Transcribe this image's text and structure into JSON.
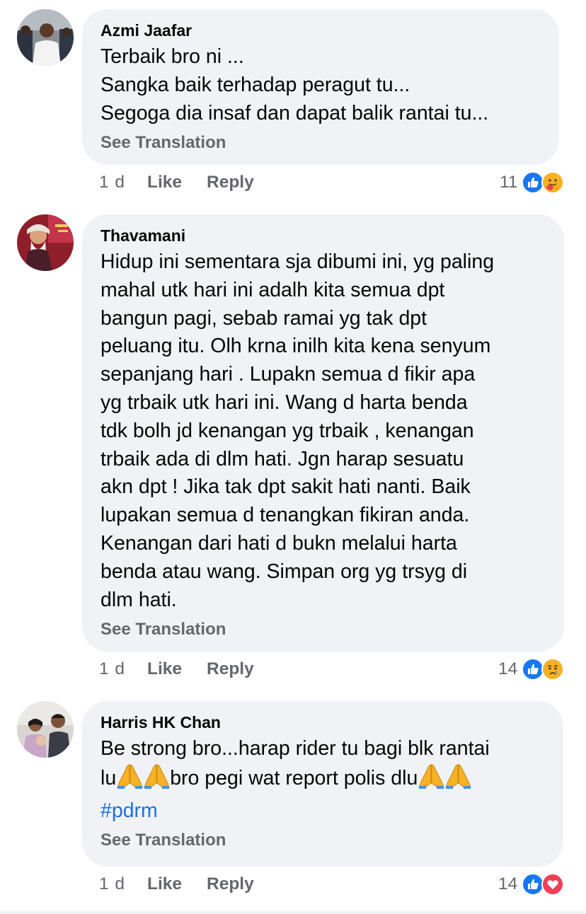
{
  "comments": [
    {
      "author": "Azmi Jaafar",
      "lines": [
        "Terbaik bro ni ...",
        "Sangka baik terhadap peragut tu...",
        "Segoga dia insaf dan dapat balik rantai tu..."
      ],
      "see_translation": "See Translation",
      "time": "1 d",
      "like": "Like",
      "reply": "Reply",
      "reaction_count": "11",
      "reactions": [
        "like-icon",
        "care-icon"
      ]
    },
    {
      "author": "Thavamani",
      "lines": [
        "Hidup ini sementara sja dibumi ini, yg paling",
        "mahal utk hari ini adalh kita semua dpt",
        "bangun pagi, sebab ramai yg tak dpt",
        "peluang itu. Olh krna inilh kita kena senyum",
        "sepanjang hari . Lupakn semua d fikir apa",
        "yg trbaik utk hari ini. Wang d harta benda",
        "tdk bolh jd kenangan yg trbaik , kenangan",
        "trbaik ada di dlm hati. Jgn harap sesuatu",
        "akn dpt ! Jika tak dpt sakit hati nanti. Baik",
        "lupakan semua d tenangkan fikiran anda.",
        "Kenangan dari hati d bukn melalui harta",
        "benda atau wang. Simpan org yg trsyg di",
        "dlm hati."
      ],
      "see_translation": "See Translation",
      "time": "1 d",
      "like": "Like",
      "reply": "Reply",
      "reaction_count": "14",
      "reactions": [
        "like-icon",
        "sad-icon"
      ]
    },
    {
      "author": "Harris HK Chan",
      "line1": "Be strong bro...harap rider tu bagi blk rantai",
      "line2_a": "lu",
      "line2_b": "bro pegi wat report polis dlu",
      "emoji": "🙏",
      "hashtag": "#pdrm",
      "see_translation": "See Translation",
      "time": "1 d",
      "like": "Like",
      "reply": "Reply",
      "reaction_count": "14",
      "reactions": [
        "like-icon",
        "love-icon"
      ]
    }
  ],
  "colors": {
    "bubble": "#f0f2f5",
    "secondary_text": "#65676b",
    "like_blue": "#1877f2",
    "love_red": "#f33e58",
    "hashtag": "#216fdb"
  }
}
